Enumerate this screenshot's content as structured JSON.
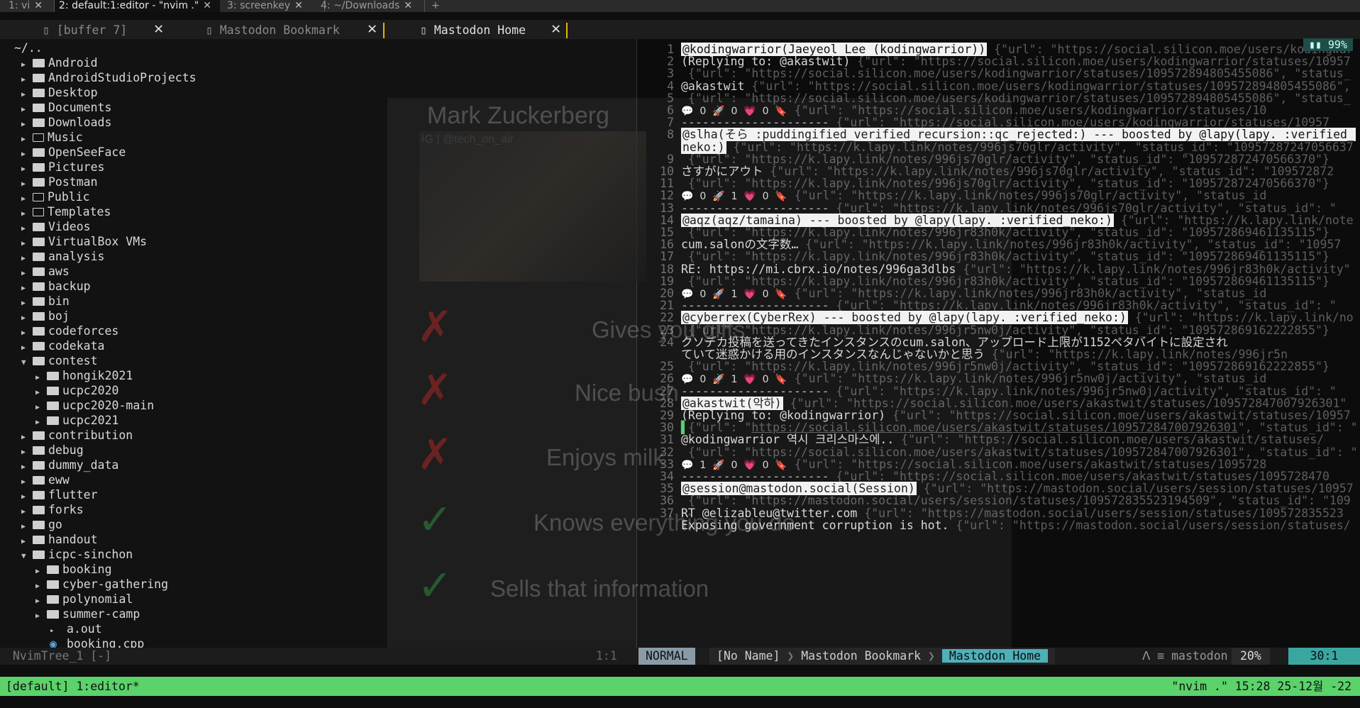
{
  "tmux_tabs": [
    {
      "label": "1: vi",
      "active": false
    },
    {
      "label": "2: default:1:editor - \"nvim .\"",
      "active": true
    },
    {
      "label": "3: screenkey",
      "active": false
    },
    {
      "label": "4: ~/Downloads",
      "active": false
    }
  ],
  "tab_close": "✕",
  "tab_add": "+",
  "buffer_tabs": [
    {
      "label": "[buffer 7]",
      "active": false
    },
    {
      "label": "Mastodon Bookmark",
      "active": false
    },
    {
      "label": "Mastodon Home",
      "active": true
    }
  ],
  "buffer_close": "✕",
  "tree": {
    "root": "~/..",
    "items": [
      {
        "name": "Android",
        "depth": 0,
        "open": false
      },
      {
        "name": "AndroidStudioProjects",
        "depth": 0,
        "open": false
      },
      {
        "name": "Desktop",
        "depth": 0,
        "open": false
      },
      {
        "name": "Documents",
        "depth": 0,
        "open": false
      },
      {
        "name": "Downloads",
        "depth": 0,
        "open": false
      },
      {
        "name": "Music",
        "depth": 0,
        "open": false,
        "outline": true
      },
      {
        "name": "OpenSeeFace",
        "depth": 0,
        "open": false
      },
      {
        "name": "Pictures",
        "depth": 0,
        "open": false
      },
      {
        "name": "Postman",
        "depth": 0,
        "open": false
      },
      {
        "name": "Public",
        "depth": 0,
        "open": false,
        "outline": true
      },
      {
        "name": "Templates",
        "depth": 0,
        "open": false,
        "outline": true
      },
      {
        "name": "Videos",
        "depth": 0,
        "open": false
      },
      {
        "name": "VirtualBox VMs",
        "depth": 0,
        "open": false
      },
      {
        "name": "analysis",
        "depth": 0,
        "open": false
      },
      {
        "name": "aws",
        "depth": 0,
        "open": false
      },
      {
        "name": "backup",
        "depth": 0,
        "open": false
      },
      {
        "name": "bin",
        "depth": 0,
        "open": false
      },
      {
        "name": "boj",
        "depth": 0,
        "open": false
      },
      {
        "name": "codeforces",
        "depth": 0,
        "open": false
      },
      {
        "name": "codekata",
        "depth": 0,
        "open": false
      },
      {
        "name": "contest",
        "depth": 0,
        "open": true
      },
      {
        "name": "hongik2021",
        "depth": 1,
        "open": false
      },
      {
        "name": "ucpc2020",
        "depth": 1,
        "open": false
      },
      {
        "name": "ucpc2020-main",
        "depth": 1,
        "open": false
      },
      {
        "name": "ucpc2021",
        "depth": 1,
        "open": false
      },
      {
        "name": "contribution",
        "depth": 0,
        "open": false
      },
      {
        "name": "debug",
        "depth": 0,
        "open": false
      },
      {
        "name": "dummy_data",
        "depth": 0,
        "open": false
      },
      {
        "name": "eww",
        "depth": 0,
        "open": false
      },
      {
        "name": "flutter",
        "depth": 0,
        "open": false
      },
      {
        "name": "forks",
        "depth": 0,
        "open": false
      },
      {
        "name": "go",
        "depth": 0,
        "open": false
      },
      {
        "name": "handout",
        "depth": 0,
        "open": false
      },
      {
        "name": "icpc-sinchon",
        "depth": 0,
        "open": true
      },
      {
        "name": "booking",
        "depth": 1,
        "open": false
      },
      {
        "name": "cyber-gathering",
        "depth": 1,
        "open": false
      },
      {
        "name": "polynomial",
        "depth": 1,
        "open": false
      },
      {
        "name": "summer-camp",
        "depth": 1,
        "open": false
      },
      {
        "name": "a.out",
        "depth": 2,
        "file": "exe"
      },
      {
        "name": "booking.cpp",
        "depth": 2,
        "file": "cpp"
      }
    ]
  },
  "overlay": {
    "name": "Mark Zuckerberg",
    "handle": "IG | @tech_on_air",
    "rows": [
      {
        "text": "Gives you gifts",
        "mark": "✗"
      },
      {
        "text": "Nice bush",
        "mark": "✗"
      },
      {
        "text": "Enjoys milk",
        "mark": "✗"
      },
      {
        "text": "Knows everything you do",
        "mark": "✓"
      },
      {
        "text": "Sells that information",
        "mark": "✓"
      }
    ]
  },
  "scroll_badge": "99%",
  "editor_lines": [
    {
      "n": "1",
      "parts": [
        {
          "t": "@kodingwarrior(Jaeyeol Lee (kodingwarrior))",
          "c": "hl"
        },
        {
          "t": " {\"url\": \"https://social.silicon.moe/users/kodingwar",
          "c": "meta"
        }
      ]
    },
    {
      "n": "2",
      "parts": [
        {
          "t": "(Replying to: @akastwit)",
          "c": ""
        },
        {
          "t": " {\"url\": \"https://social.silicon.moe/users/kodingwarrior/statuses/10957",
          "c": "meta"
        }
      ]
    },
    {
      "n": "3",
      "parts": [
        {
          "t": " {\"url\": \"https://social.silicon.moe/users/kodingwarrior/statuses/109572894805455086\", \"status_",
          "c": "meta"
        }
      ]
    },
    {
      "n": "4",
      "parts": [
        {
          "t": "@akastwit",
          "c": ""
        },
        {
          "t": " {\"url\": \"https://social.silicon.moe/users/kodingwarrior/statuses/109572894805455086\",",
          "c": "meta"
        }
      ]
    },
    {
      "n": "5",
      "parts": [
        {
          "t": " {\"url\": \"https://social.silicon.moe/users/kodingwarrior/statuses/109572894805455086\", \"status_",
          "c": "meta"
        }
      ]
    },
    {
      "n": "6",
      "parts": [
        {
          "t": "💬  0  🚀  0  💗  0  🔖",
          "c": "stats"
        },
        {
          "t": " {\"url\": \"https://social.silicon.moe/users/kodingwarrior/statuses/10",
          "c": "meta"
        }
      ]
    },
    {
      "n": "7",
      "parts": [
        {
          "t": "---------------------",
          "c": "sep-dash"
        },
        {
          "t": " {\"url\": \"https://social.silicon.moe/users/kodingwarrior/statuses/10957",
          "c": "meta"
        }
      ]
    },
    {
      "n": "8",
      "parts": [
        {
          "t": "@slha(そら :puddingified_verified_recursion::qc_rejected:) --- boosted by @lapy(lapy. :verified_",
          "c": "hl"
        }
      ]
    },
    {
      "n": "",
      "parts": [
        {
          "t": "neko:)",
          "c": "hl"
        },
        {
          "t": " {\"url\": \"https://k.lapy.link/notes/996js70glr/activity\", \"status_id\": \"10957287247056637",
          "c": "meta"
        }
      ]
    },
    {
      "n": "9",
      "parts": [
        {
          "t": " {\"url\": \"https://k.lapy.link/notes/996js70glr/activity\", \"status_id\": \"109572872470566370\"}",
          "c": "meta"
        }
      ]
    },
    {
      "n": "10",
      "parts": [
        {
          "t": "さすがにアウト",
          "c": ""
        },
        {
          "t": " {\"url\": \"https://k.lapy.link/notes/996js70glr/activity\", \"status_id\": \"109572872",
          "c": "meta"
        }
      ]
    },
    {
      "n": "11",
      "parts": [
        {
          "t": " {\"url\": \"https://k.lapy.link/notes/996js70glr/activity\", \"status_id\": \"109572872470566370\"}",
          "c": "meta"
        }
      ]
    },
    {
      "n": "12",
      "parts": [
        {
          "t": "💬  0  🚀  1  💗  0  🔖",
          "c": "stats"
        },
        {
          "t": " {\"url\": \"https://k.lapy.link/notes/996js70glr/activity\", \"status_id",
          "c": "meta"
        }
      ]
    },
    {
      "n": "13",
      "parts": [
        {
          "t": "---------------------",
          "c": "sep-dash"
        },
        {
          "t": " {\"url\": \"https://k.lapy.link/notes/996js70glr/activity\", \"status_id\": \"",
          "c": "meta"
        }
      ]
    },
    {
      "n": "14",
      "parts": [
        {
          "t": "@aqz(aqz/tamaina) --- boosted by @lapy(lapy. :verified_neko:)",
          "c": "hl"
        },
        {
          "t": " {\"url\": \"https://k.lapy.link/note",
          "c": "meta"
        }
      ]
    },
    {
      "n": "15",
      "parts": [
        {
          "t": " {\"url\": \"https://k.lapy.link/notes/996jr83h0k/activity\", \"status_id\": \"109572869461135115\"}",
          "c": "meta"
        }
      ]
    },
    {
      "n": "16",
      "parts": [
        {
          "t": "cum.salonの文字数…",
          "c": ""
        },
        {
          "t": " {\"url\": \"https://k.lapy.link/notes/996jr83h0k/activity\", \"status_id\": \"10957",
          "c": "meta"
        }
      ]
    },
    {
      "n": "17",
      "parts": [
        {
          "t": " {\"url\": \"https://k.lapy.link/notes/996jr83h0k/activity\", \"status_id\": \"109572869461135115\"}",
          "c": "meta"
        }
      ]
    },
    {
      "n": "18",
      "parts": [
        {
          "t": "RE: https://mi.cbrx.io/notes/996ga3dlbs",
          "c": ""
        },
        {
          "t": " {\"url\": \"https://k.lapy.link/notes/996jr83h0k/activity\"",
          "c": "meta"
        }
      ]
    },
    {
      "n": "19",
      "parts": [
        {
          "t": " {\"url\": \"https://k.lapy.link/notes/996jr83h0k/activity\", \"status_id\": \"109572869461135115\"}",
          "c": "meta"
        }
      ]
    },
    {
      "n": "20",
      "parts": [
        {
          "t": "💬  0  🚀  1  💗  0  🔖",
          "c": "stats"
        },
        {
          "t": " {\"url\": \"https://k.lapy.link/notes/996jr83h0k/activity\", \"status_id",
          "c": "meta"
        }
      ]
    },
    {
      "n": "21",
      "parts": [
        {
          "t": "---------------------",
          "c": "sep-dash"
        },
        {
          "t": " {\"url\": \"https://k.lapy.link/notes/996jr83h0k/activity\", \"status_id\": \"",
          "c": "meta"
        }
      ]
    },
    {
      "n": "22",
      "parts": [
        {
          "t": "@cyberrex(CyberRex) --- boosted by @lapy(lapy. :verified_neko:)",
          "c": "hl"
        },
        {
          "t": " {\"url\": \"https://k.lapy.link/no",
          "c": "meta"
        }
      ]
    },
    {
      "n": "23",
      "parts": [
        {
          "t": " {\"url\": \"https://k.lapy.link/notes/996jr5nw0j/activity\", \"status_id\": \"109572869162222855\"}",
          "c": "meta"
        }
      ]
    },
    {
      "n": "24",
      "parts": [
        {
          "t": "クソデカ投稿を送ってきたインスタンスのcum.salon、アップロード上限が1152ペタバイトに設定され",
          "c": ""
        }
      ]
    },
    {
      "n": "",
      "parts": [
        {
          "t": "ていて迷惑かける用のインスタンスなんじゃないかと思う",
          "c": ""
        },
        {
          "t": " {\"url\": \"https://k.lapy.link/notes/996jr5n",
          "c": "meta"
        }
      ]
    },
    {
      "n": "25",
      "parts": [
        {
          "t": " {\"url\": \"https://k.lapy.link/notes/996jr5nw0j/activity\", \"status_id\": \"109572869162222855\"}",
          "c": "meta"
        }
      ]
    },
    {
      "n": "26",
      "parts": [
        {
          "t": "💬  0  🚀  1  💗  0  🔖",
          "c": "stats"
        },
        {
          "t": " {\"url\": \"https://k.lapy.link/notes/996jr5nw0j/activity\", \"status_id",
          "c": "meta"
        }
      ]
    },
    {
      "n": "27",
      "parts": [
        {
          "t": "---------------------",
          "c": "sep-dash"
        },
        {
          "t": " {\"url\": \"https://k.lapy.link/notes/996jr5nw0j/activity\", \"status_id\": \"",
          "c": "meta"
        }
      ]
    },
    {
      "n": "28",
      "parts": [
        {
          "t": "@akastwit(악하)",
          "c": "hl"
        },
        {
          "t": " {\"url\": \"https://social.silicon.moe/users/akastwit/statuses/109572847007926301\"",
          "c": "meta"
        }
      ]
    },
    {
      "n": "29",
      "parts": [
        {
          "t": "(Replying to: @kodingwarrior)",
          "c": ""
        },
        {
          "t": " {\"url\": \"https://social.silicon.moe/users/akastwit/statuses/10957",
          "c": "meta"
        }
      ]
    },
    {
      "n": "30",
      "parts": [
        {
          "t": "▌",
          "c": "cursor"
        },
        {
          "t": "{\"url\": \"",
          "c": "meta"
        },
        {
          "t": "https://social.silicon.moe/users/akastwit/statuses/109572847007926301",
          "c": "meta url-u"
        },
        {
          "t": "\", \"status_id\": \"",
          "c": "meta"
        }
      ]
    },
    {
      "n": "31",
      "parts": [
        {
          "t": "@kodingwarrior 역시 크리스마스에..",
          "c": ""
        },
        {
          "t": " {\"url\": \"https://social.silicon.moe/users/akastwit/statuses/",
          "c": "meta"
        }
      ]
    },
    {
      "n": "32",
      "parts": [
        {
          "t": " {\"url\": \"https://social.silicon.moe/users/akastwit/statuses/109572847007926301\", \"status_id\": \"",
          "c": "meta"
        }
      ]
    },
    {
      "n": "33",
      "parts": [
        {
          "t": "💬  1  🚀  0  💗  0  🔖",
          "c": "stats"
        },
        {
          "t": " {\"url\": \"https://social.silicon.moe/users/akastwit/statuses/1095728",
          "c": "meta"
        }
      ]
    },
    {
      "n": "34",
      "parts": [
        {
          "t": "---------------------",
          "c": "sep-dash"
        },
        {
          "t": " {\"url\": \"https://social.silicon.moe/users/akastwit/statuses/1095728470",
          "c": "meta"
        }
      ]
    },
    {
      "n": "35",
      "parts": [
        {
          "t": "@session@mastodon.social(Session)",
          "c": "hl"
        },
        {
          "t": " {\"url\": \"https://mastodon.social/users/session/statuses/10957",
          "c": "meta"
        }
      ]
    },
    {
      "n": "36",
      "parts": [
        {
          "t": " {\"url\": \"https://mastodon.social/users/session/statuses/109572835523194509\", \"status_id\": \"109",
          "c": "meta"
        }
      ]
    },
    {
      "n": "37",
      "parts": [
        {
          "t": "RT @elizableu@twitter.com",
          "c": ""
        },
        {
          "t": " {\"url\": \"https://mastodon.social/users/session/statuses/109572835523",
          "c": "meta"
        }
      ]
    },
    {
      "n": "",
      "parts": [
        {
          "t": "Exposing government corruption is hot.",
          "c": ""
        },
        {
          "t": " {\"url\": \"https://mastodon.social/users/session/statuses/",
          "c": "meta"
        }
      ]
    }
  ],
  "statusline": {
    "tree_name": "NvimTree_1 [-]",
    "tree_pos": "1:1",
    "mode": "NORMAL",
    "crumbs": [
      "[No Name]",
      "Mastodon Bookmark",
      "Mastodon Home"
    ],
    "crumb_sep": "❯",
    "filetype": "mastodon",
    "percent": "20%",
    "pos": "30:1"
  },
  "tmux_status": {
    "left": "[default] 1:editor*",
    "right": "\"nvim .\" 15:28 25-12월 -22"
  },
  "colors": {
    "mode_bg": "#8a9ba8",
    "tmux_bg": "#5bd26a",
    "crumb_active": "#4fb0b8"
  }
}
